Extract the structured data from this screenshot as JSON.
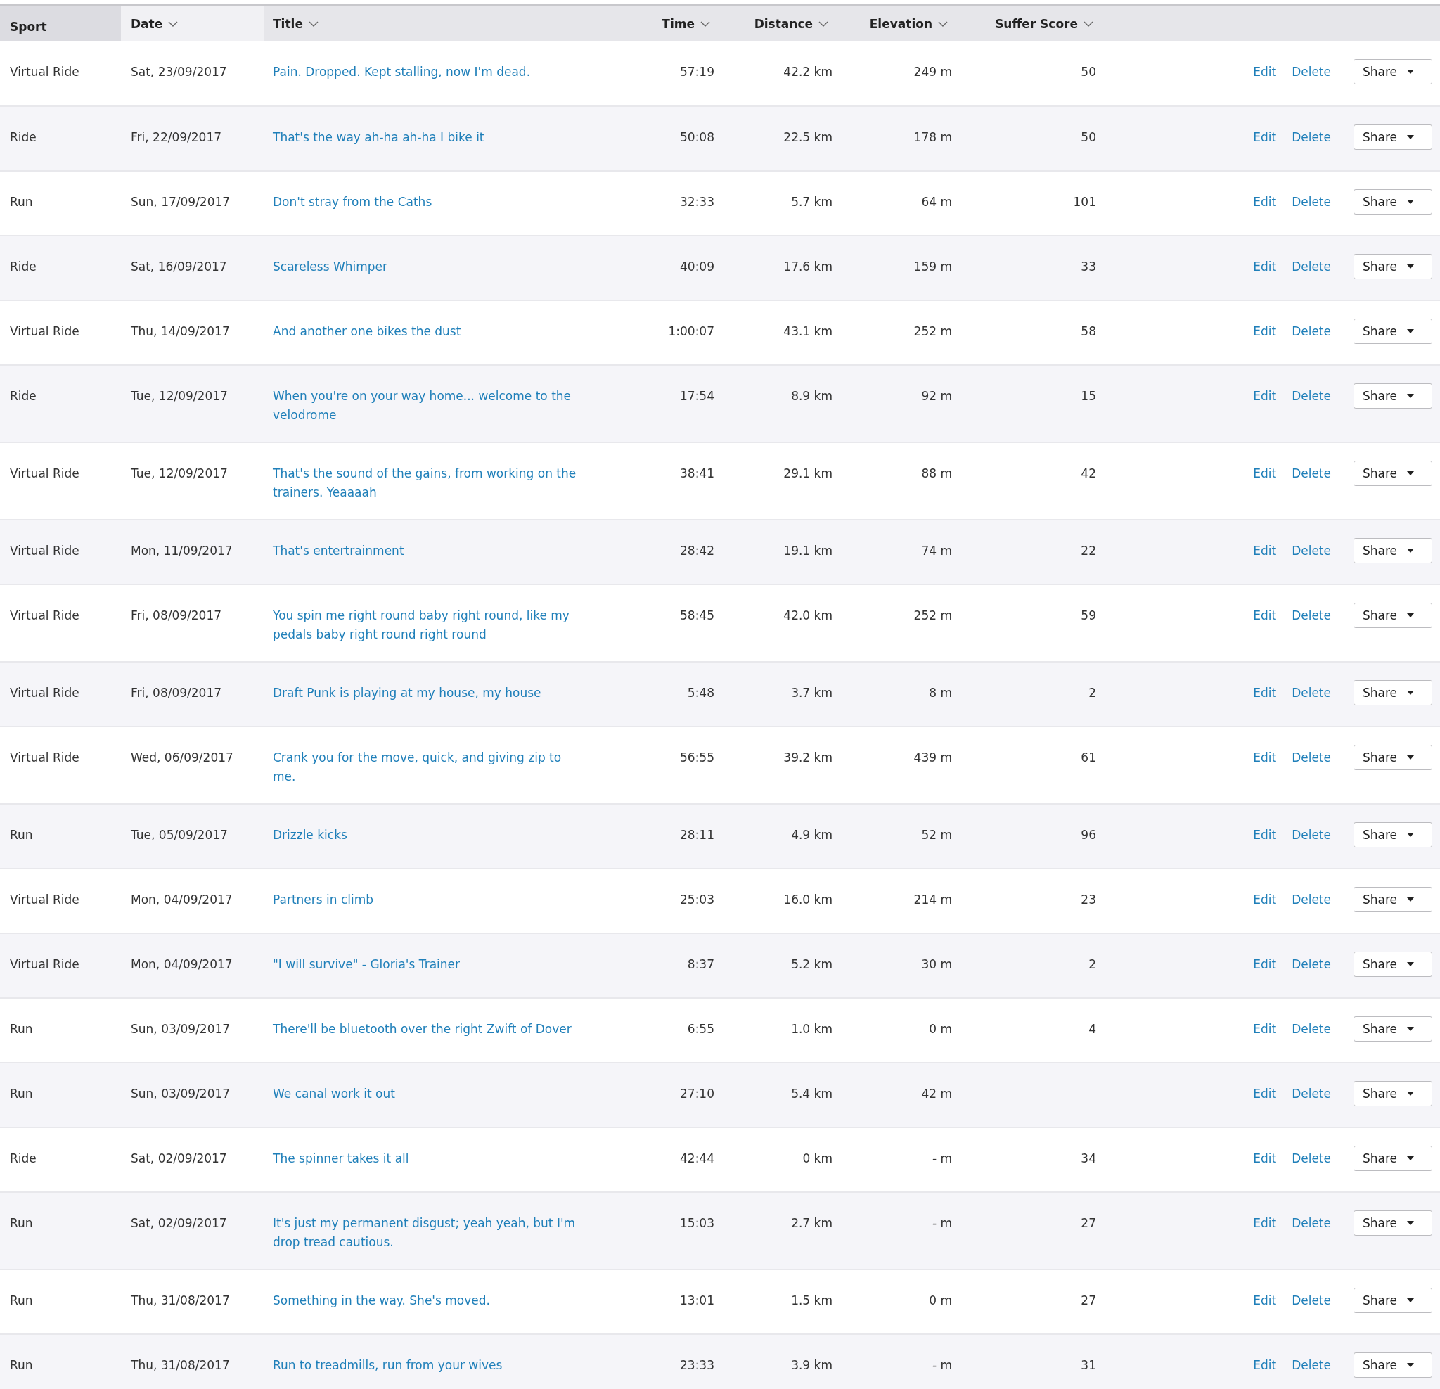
{
  "table": {
    "columns": [
      {
        "label": "Sport",
        "sortable": false,
        "sorted": false
      },
      {
        "label": "Date",
        "sortable": true,
        "sorted": true
      },
      {
        "label": "Title",
        "sortable": true,
        "sorted": false
      },
      {
        "label": "Time",
        "sortable": true,
        "sorted": false
      },
      {
        "label": "Distance",
        "sortable": true,
        "sorted": false
      },
      {
        "label": "Elevation",
        "sortable": true,
        "sorted": false
      },
      {
        "label": "Suffer Score",
        "sortable": true,
        "sorted": false
      }
    ],
    "rows": [
      {
        "sport": "Virtual Ride",
        "date": "Sat, 23/09/2017",
        "title": "Pain. Dropped. Kept stalling, now I'm dead.",
        "time": "57:19",
        "distance": "42.2 km",
        "elevation": "249 m",
        "suffer_score": "50",
        "edit": "Edit",
        "delete": "Delete",
        "share": "Share"
      },
      {
        "sport": "Ride",
        "date": "Fri, 22/09/2017",
        "title": "That's the way ah-ha ah-ha I bike it",
        "time": "50:08",
        "distance": "22.5 km",
        "elevation": "178 m",
        "suffer_score": "50",
        "edit": "Edit",
        "delete": "Delete",
        "share": "Share"
      },
      {
        "sport": "Run",
        "date": "Sun, 17/09/2017",
        "title": "Don't stray from the Caths",
        "time": "32:33",
        "distance": "5.7 km",
        "elevation": "64 m",
        "suffer_score": "101",
        "edit": "Edit",
        "delete": "Delete",
        "share": "Share"
      },
      {
        "sport": "Ride",
        "date": "Sat, 16/09/2017",
        "title": "Scareless Whimper",
        "time": "40:09",
        "distance": "17.6 km",
        "elevation": "159 m",
        "suffer_score": "33",
        "edit": "Edit",
        "delete": "Delete",
        "share": "Share"
      },
      {
        "sport": "Virtual Ride",
        "date": "Thu, 14/09/2017",
        "title": "And another one bikes the dust",
        "time": "1:00:07",
        "distance": "43.1 km",
        "elevation": "252 m",
        "suffer_score": "58",
        "edit": "Edit",
        "delete": "Delete",
        "share": "Share"
      },
      {
        "sport": "Ride",
        "date": "Tue, 12/09/2017",
        "title": "When you're on your way home... welcome to the velodrome",
        "time": "17:54",
        "distance": "8.9 km",
        "elevation": "92 m",
        "suffer_score": "15",
        "edit": "Edit",
        "delete": "Delete",
        "share": "Share"
      },
      {
        "sport": "Virtual Ride",
        "date": "Tue, 12/09/2017",
        "title": "That's the sound of the gains, from working on the trainers. Yeaaaah",
        "time": "38:41",
        "distance": "29.1 km",
        "elevation": "88 m",
        "suffer_score": "42",
        "edit": "Edit",
        "delete": "Delete",
        "share": "Share"
      },
      {
        "sport": "Virtual Ride",
        "date": "Mon, 11/09/2017",
        "title": "That's entertrainment",
        "time": "28:42",
        "distance": "19.1 km",
        "elevation": "74 m",
        "suffer_score": "22",
        "edit": "Edit",
        "delete": "Delete",
        "share": "Share"
      },
      {
        "sport": "Virtual Ride",
        "date": "Fri, 08/09/2017",
        "title": "You spin me right round baby right round, like my pedals baby right round right round",
        "time": "58:45",
        "distance": "42.0 km",
        "elevation": "252 m",
        "suffer_score": "59",
        "edit": "Edit",
        "delete": "Delete",
        "share": "Share"
      },
      {
        "sport": "Virtual Ride",
        "date": "Fri, 08/09/2017",
        "title": "Draft Punk is playing at my house, my house",
        "time": "5:48",
        "distance": "3.7 km",
        "elevation": "8 m",
        "suffer_score": "2",
        "edit": "Edit",
        "delete": "Delete",
        "share": "Share"
      },
      {
        "sport": "Virtual Ride",
        "date": "Wed, 06/09/2017",
        "title": "Crank you for the move, quick, and giving zip to me.",
        "time": "56:55",
        "distance": "39.2 km",
        "elevation": "439 m",
        "suffer_score": "61",
        "edit": "Edit",
        "delete": "Delete",
        "share": "Share"
      },
      {
        "sport": "Run",
        "date": "Tue, 05/09/2017",
        "title": "Drizzle kicks",
        "time": "28:11",
        "distance": "4.9 km",
        "elevation": "52 m",
        "suffer_score": "96",
        "edit": "Edit",
        "delete": "Delete",
        "share": "Share"
      },
      {
        "sport": "Virtual Ride",
        "date": "Mon, 04/09/2017",
        "title": "Partners in climb",
        "time": "25:03",
        "distance": "16.0 km",
        "elevation": "214 m",
        "suffer_score": "23",
        "edit": "Edit",
        "delete": "Delete",
        "share": "Share"
      },
      {
        "sport": "Virtual Ride",
        "date": "Mon, 04/09/2017",
        "title": "\"I will survive\" - Gloria's Trainer",
        "time": "8:37",
        "distance": "5.2 km",
        "elevation": "30 m",
        "suffer_score": "2",
        "edit": "Edit",
        "delete": "Delete",
        "share": "Share"
      },
      {
        "sport": "Run",
        "date": "Sun, 03/09/2017",
        "title": "There'll be bluetooth over the right Zwift of Dover",
        "time": "6:55",
        "distance": "1.0 km",
        "elevation": "0 m",
        "suffer_score": "4",
        "edit": "Edit",
        "delete": "Delete",
        "share": "Share"
      },
      {
        "sport": "Run",
        "date": "Sun, 03/09/2017",
        "title": "We canal work it out",
        "time": "27:10",
        "distance": "5.4 km",
        "elevation": "42 m",
        "edit": "Edit",
        "delete": "Delete",
        "share": "Share"
      },
      {
        "sport": "Ride",
        "date": "Sat, 02/09/2017",
        "title": "The spinner takes it all",
        "time": "42:44",
        "distance": "0 km",
        "elevation": "- m",
        "suffer_score": "34",
        "edit": "Edit",
        "delete": "Delete",
        "share": "Share"
      },
      {
        "sport": "Run",
        "date": "Sat, 02/09/2017",
        "title": "It's just my permanent disgust; yeah yeah, but I'm drop tread cautious.",
        "time": "15:03",
        "distance": "2.7 km",
        "elevation": "- m",
        "suffer_score": "27",
        "edit": "Edit",
        "delete": "Delete",
        "share": "Share"
      },
      {
        "sport": "Run",
        "date": "Thu, 31/08/2017",
        "title": "Something in the way. She's moved.",
        "time": "13:01",
        "distance": "1.5 km",
        "elevation": "0 m",
        "suffer_score": "27",
        "edit": "Edit",
        "delete": "Delete",
        "share": "Share"
      },
      {
        "sport": "Run",
        "date": "Thu, 31/08/2017",
        "title": "Run to treadmills, run from your wives",
        "time": "23:33",
        "distance": "3.9 km",
        "elevation": "- m",
        "suffer_score": "31",
        "edit": "Edit",
        "delete": "Delete",
        "share": "Share"
      }
    ]
  }
}
